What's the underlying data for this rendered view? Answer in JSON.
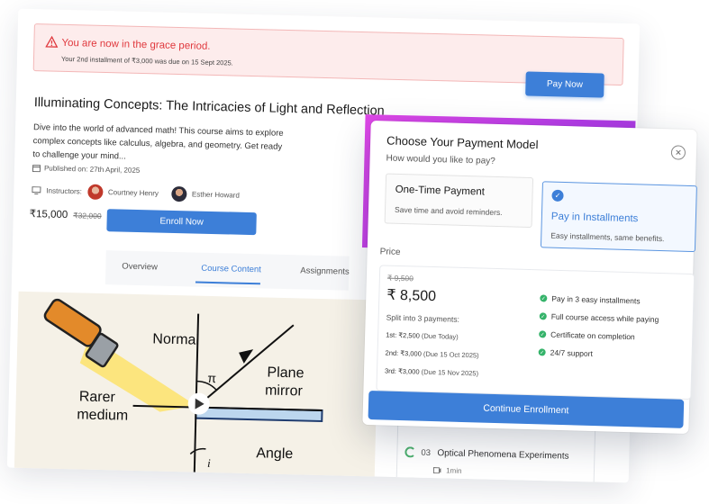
{
  "grace": {
    "title": "You are now in the grace period.",
    "subtitle": "Your 2nd installment of ₹3,000 was due on 15 Sept 2025.",
    "pay_now": "Pay Now"
  },
  "course": {
    "title": "Illuminating Concepts: The Intricacies of Light and Reflection",
    "description": "Dive into the world of advanced math! This course aims to explore complex concepts like calculus, algebra, and geometry. Get ready to challenge your mind...",
    "published": "Published on: 27th April, 2025",
    "instructors_label": "Instructors:",
    "instructors": [
      "Courtney Henry",
      "Esther Howard"
    ],
    "price": "₹15,000",
    "price_old": "₹32,000",
    "enroll_now": "Enroll Now",
    "tabs": [
      "Overview",
      "Course Content",
      "Assignments"
    ],
    "active_tab": "Course Content"
  },
  "diagram": {
    "labels": [
      "Normal",
      "π",
      "Plane",
      "mirror",
      "Rarer",
      "medium",
      "Angle",
      "i"
    ]
  },
  "lesson": {
    "number": "03",
    "title": "Optical Phenomena Experiments",
    "duration": "1min"
  },
  "modal": {
    "title": "Choose Your Payment Model",
    "subtitle": "How would you like to pay?",
    "option_one": {
      "title": "One-Time Payment",
      "desc": "Save time and avoid reminders."
    },
    "option_install": {
      "title": "Pay in Installments",
      "desc": "Easy installments, same benefits."
    },
    "price_label": "Price",
    "price_old": "₹ 9,500",
    "price_new": "₹ 8,500",
    "split_text": "Split into 3 payments:",
    "installments": [
      {
        "label": "1st:",
        "amount": "₹2,500",
        "due": "(Due Today)"
      },
      {
        "label": "2nd:",
        "amount": "₹3,000",
        "due": "(Due 15 Oct 2025)"
      },
      {
        "label": "3rd:",
        "amount": "₹3,000",
        "due": "(Due 15 Nov 2025)"
      }
    ],
    "features": [
      "Pay in 3 easy installments",
      "Full course access while paying",
      "Certificate on completion",
      "24/7 support"
    ],
    "continue": "Continue Enrollment"
  },
  "colors": {
    "accent": "#3d7fd8",
    "danger": "#e0393e",
    "success": "#35b36a"
  }
}
